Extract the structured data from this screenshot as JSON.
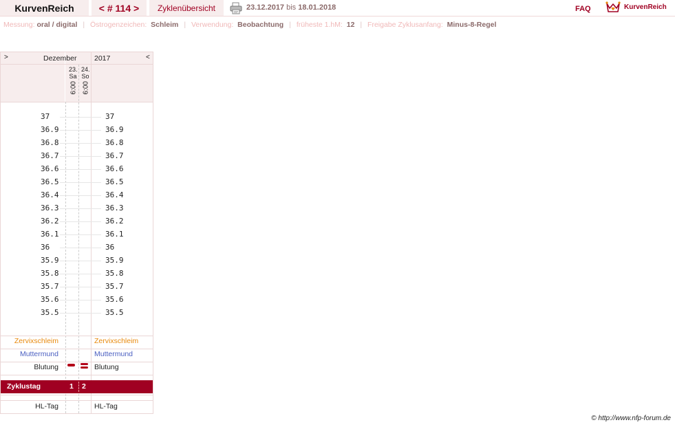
{
  "header": {
    "app_title": "KurvenReich",
    "cycle_prev": "<",
    "cycle_number": "# 114",
    "cycle_next": ">",
    "overview_tab": "Zyklenübersicht",
    "date_from": "23.12.2017",
    "date_conj": "bis",
    "date_to": "18.01.2018",
    "faq": "FAQ",
    "brand": "KurvenReich"
  },
  "info": {
    "messung_label": "Messung:",
    "messung_value": "oral / digital",
    "oestrogen_label": "Östrogenzeichen:",
    "oestrogen_value": "Schleim",
    "verwendung_label": "Verwendung:",
    "verwendung_value": "Beobachtung",
    "hm_label": "früheste 1.hM:",
    "hm_value": "12",
    "freigabe_label": "Freigabe Zyklusanfang:",
    "freigabe_value": "Minus-8-Regel"
  },
  "chart": {
    "nav_prev": ">",
    "nav_next": "<",
    "month": "Dezember",
    "year": "2017",
    "days": [
      {
        "date": "23.",
        "weekday": "Sa",
        "time": "6:00",
        "cycle_day": "1"
      },
      {
        "date": "24.",
        "weekday": "So",
        "time": "6:00",
        "cycle_day": "2"
      }
    ],
    "temperatures": [
      "37",
      "36.9",
      "36.8",
      "36.7",
      "36.6",
      "36.5",
      "36.4",
      "36.3",
      "36.2",
      "36.1",
      "36",
      "35.9",
      "35.8",
      "35.7",
      "35.6",
      "35.5"
    ],
    "rows": {
      "zervix": "Zervixschleim",
      "muttermund": "Muttermund",
      "blutung": "Blutung",
      "zyklustag": "Zyklustag",
      "hltag": "HL-Tag"
    },
    "colors": {
      "accent": "#a00022",
      "zervix": "#e8890c",
      "muttermund": "#4a5fc1"
    }
  },
  "footer": {
    "credit": "© http://www.nfp-forum.de"
  }
}
